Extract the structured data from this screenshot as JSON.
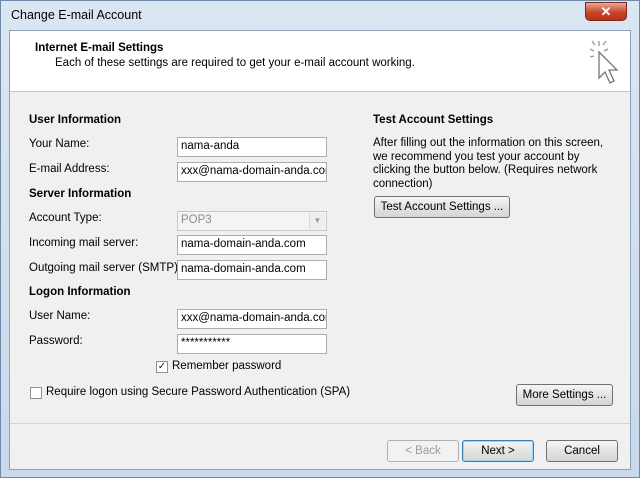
{
  "window": {
    "title": "Change E-mail Account",
    "close_glyph": "✕"
  },
  "header": {
    "title": "Internet E-mail Settings",
    "subtitle": "Each of these settings are required to get your e-mail account working."
  },
  "user_info": {
    "heading": "User Information",
    "name_label": "Your Name:",
    "name_value": "nama-anda",
    "email_label": "E-mail Address:",
    "email_value": "xxx@nama-domain-anda.com"
  },
  "server_info": {
    "heading": "Server Information",
    "account_type_label": "Account Type:",
    "account_type_value": "POP3",
    "incoming_label": "Incoming mail server:",
    "incoming_value": "nama-domain-anda.com",
    "outgoing_label": "Outgoing mail server (SMTP):",
    "outgoing_value": "nama-domain-anda.com"
  },
  "logon_info": {
    "heading": "Logon Information",
    "username_label": "User Name:",
    "username_value": "xxx@nama-domain-anda.com",
    "password_label": "Password:",
    "password_value": "***********",
    "remember_label": "Remember password",
    "remember_checked": true,
    "spa_label": "Require logon using Secure Password Authentication (SPA)",
    "spa_checked": false
  },
  "test_settings": {
    "heading": "Test Account Settings",
    "description": "After filling out the information on this screen, we recommend you test your account by clicking the button below. (Requires network connection)",
    "button_label": "Test Account Settings ..."
  },
  "buttons": {
    "more_settings": "More Settings ...",
    "back": "< Back",
    "next": "Next >",
    "cancel": "Cancel"
  },
  "colors": {
    "accent": "#3c7fb1",
    "close": "#c9452a"
  }
}
